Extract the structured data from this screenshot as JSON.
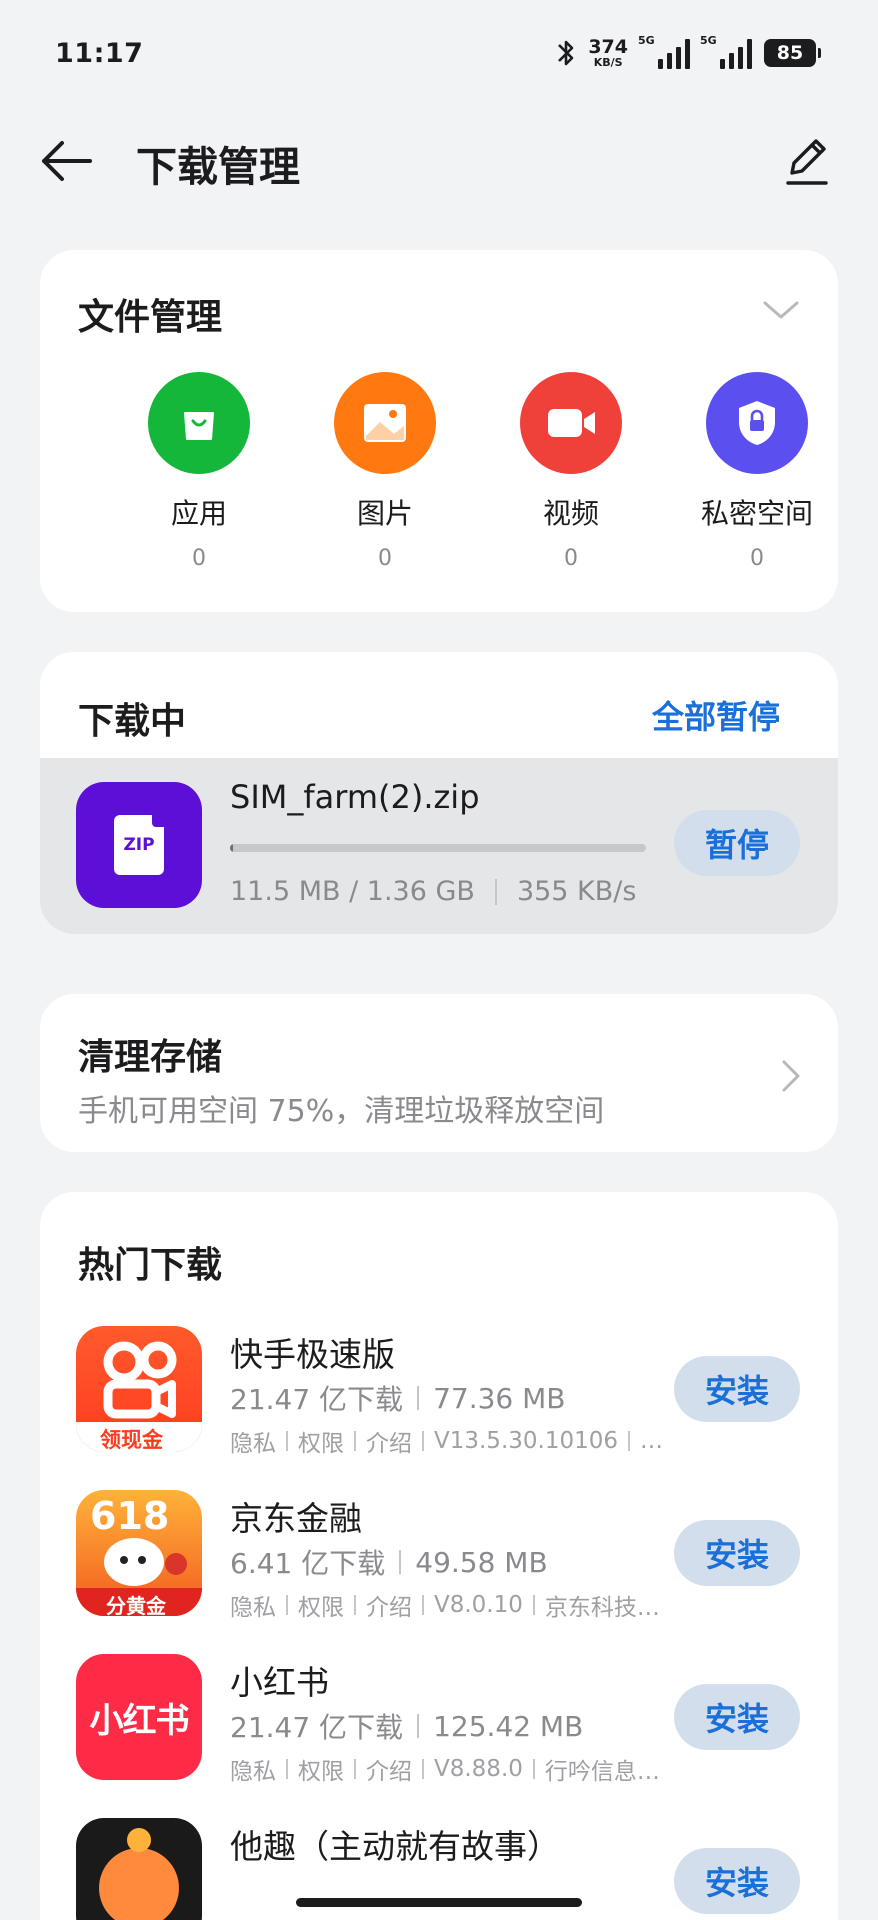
{
  "status": {
    "time": "11:17",
    "net_speed": "374",
    "net_unit": "KB/S",
    "sim1": "5G",
    "sim2": "5G",
    "battery": "85"
  },
  "header": {
    "title": "下载管理",
    "back_icon": "arrow-left-icon",
    "edit_icon": "pencil-icon"
  },
  "file_management": {
    "title": "文件管理",
    "items": [
      {
        "label": "应用",
        "count": "0",
        "color": "#15b73b",
        "icon": "shopping-bag-icon"
      },
      {
        "label": "图片",
        "count": "0",
        "color": "#ff7810",
        "icon": "image-icon"
      },
      {
        "label": "视频",
        "count": "0",
        "color": "#f0403a",
        "icon": "video-camera-icon"
      },
      {
        "label": "私密空间",
        "count": "0",
        "color": "#5b4ff0",
        "icon": "shield-lock-icon"
      }
    ]
  },
  "downloading": {
    "title": "下载中",
    "pause_all": "全部暂停",
    "item": {
      "name": "SIM_farm(2).zip",
      "icon_text": "ZIP",
      "progress_text": "11.5 MB / 1.36 GB",
      "speed": "355 KB/s",
      "progress": 0.0083,
      "button": "暂停"
    }
  },
  "clean_storage": {
    "title": "清理存储",
    "subtitle": "手机可用空间 75%，清理垃圾释放空间"
  },
  "hot_downloads": {
    "title": "热门下载",
    "apps": [
      {
        "name": "快手极速版",
        "downloads": "21.47 亿下载",
        "size": "77.36 MB",
        "links": [
          "隐私",
          "权限",
          "介绍",
          "V13.5.30.10106",
          "…"
        ],
        "button": "安装",
        "icon_text": "领现金"
      },
      {
        "name": "京东金融",
        "downloads": "6.41 亿下载",
        "size": "49.58 MB",
        "links": [
          "隐私",
          "权限",
          "介绍",
          "V8.0.10",
          "京东科技…"
        ],
        "button": "安装",
        "icon_text": "分黄金",
        "icon_top": "618"
      },
      {
        "name": "小红书",
        "downloads": "21.47 亿下载",
        "size": "125.42 MB",
        "links": [
          "隐私",
          "权限",
          "介绍",
          "V8.88.0",
          "行吟信息…"
        ],
        "button": "安装",
        "icon_text": "小红书"
      },
      {
        "name": "他趣（主动就有故事）",
        "downloads": "",
        "size": "",
        "links": [],
        "button": "安装",
        "icon_text": ""
      }
    ]
  }
}
